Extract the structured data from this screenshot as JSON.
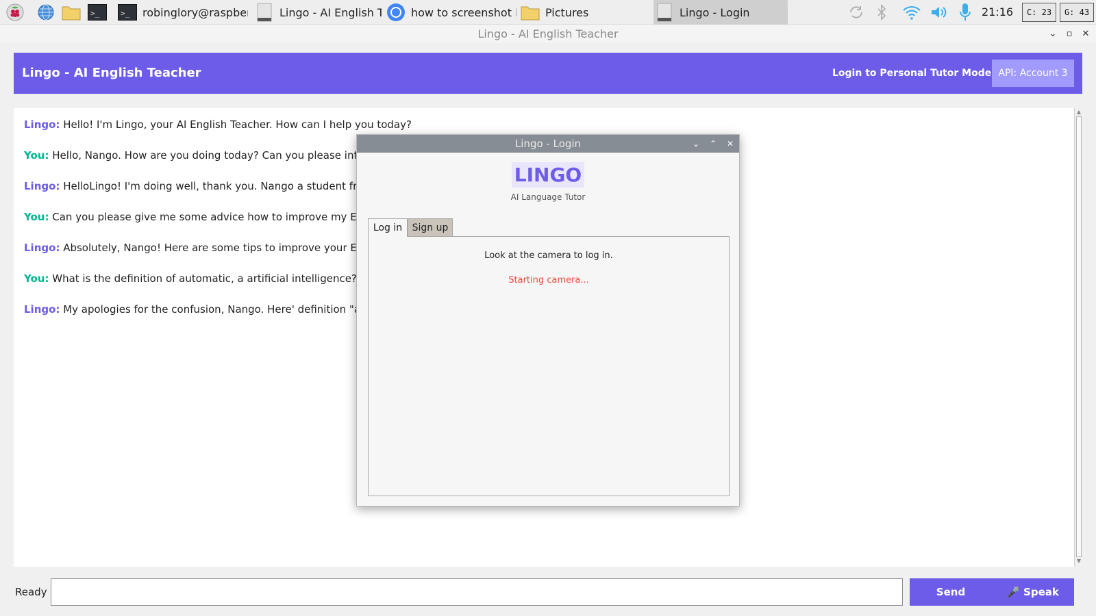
{
  "taskbar": {
    "tasks": [
      {
        "label": "robinglory@raspberr..",
        "icon": "terminal-icon"
      },
      {
        "label": "Lingo - AI English Te..",
        "icon": "app-window-icon"
      },
      {
        "label": "how to screenshot in..",
        "icon": "chromium-icon"
      },
      {
        "label": "Pictures",
        "icon": "folder-icon"
      },
      {
        "label": "Lingo - Login",
        "icon": "app-window-icon"
      }
    ],
    "clock": "21:16",
    "cpu_meter": "C: 23",
    "gpu_meter": "G: 43",
    "colors": {
      "accent": "#3daee9"
    }
  },
  "window": {
    "title": "Lingo - AI English Teacher"
  },
  "header": {
    "title": "Lingo - AI English Teacher",
    "tutor_link": "Login to Personal Tutor Mode",
    "api_button": "API: Account 3",
    "colors": {
      "bar": "#6c5ce7",
      "api_button": "#a29bfe"
    }
  },
  "chat": {
    "messages": [
      {
        "speaker": "Lingo:",
        "role": "lingo",
        "text": "Hello! I'm Lingo, your AI English Teacher. How can I help you today?"
      },
      {
        "speaker": "You:",
        "role": "you",
        "text": "Hello, Nango. How are you doing today? Can you please introdu"
      },
      {
        "speaker": "Lingo:",
        "role": "lingo",
        "text": "HelloLingo! I'm doing well, thank you. Nango a student from S"
      },
      {
        "speaker": "You:",
        "role": "you",
        "text": "Can you please give me some advice how to improve my English"
      },
      {
        "speaker": "Lingo:",
        "role": "lingo",
        "text": "Absolutely, Nango! Here are some tips to improve your English"
      },
      {
        "speaker": "You:",
        "role": "you",
        "text": "What is the definition of automatic, a artificial intelligence?"
      },
      {
        "speaker": "Lingo:",
        "role": "lingo",
        "text": "My apologies for the confusion, Nango. Here' definition \"auton"
      }
    ],
    "colors": {
      "lingo": "#6c5ce7",
      "you": "#00b894"
    }
  },
  "footer": {
    "status": "Ready",
    "input_value": "",
    "send_label": "Send",
    "speak_label": "🎤 Speak"
  },
  "dialog": {
    "title": "Lingo - Login",
    "brand": "LINGO",
    "tagline": "AI Language Tutor",
    "tabs": [
      {
        "label": "Log in",
        "selected": true
      },
      {
        "label": "Sign up",
        "selected": false
      }
    ],
    "hint": "Look at the camera to log in.",
    "camera_status": "Starting camera...",
    "colors": {
      "status": "#e74c3c",
      "brand": "#6c5ce7"
    }
  }
}
